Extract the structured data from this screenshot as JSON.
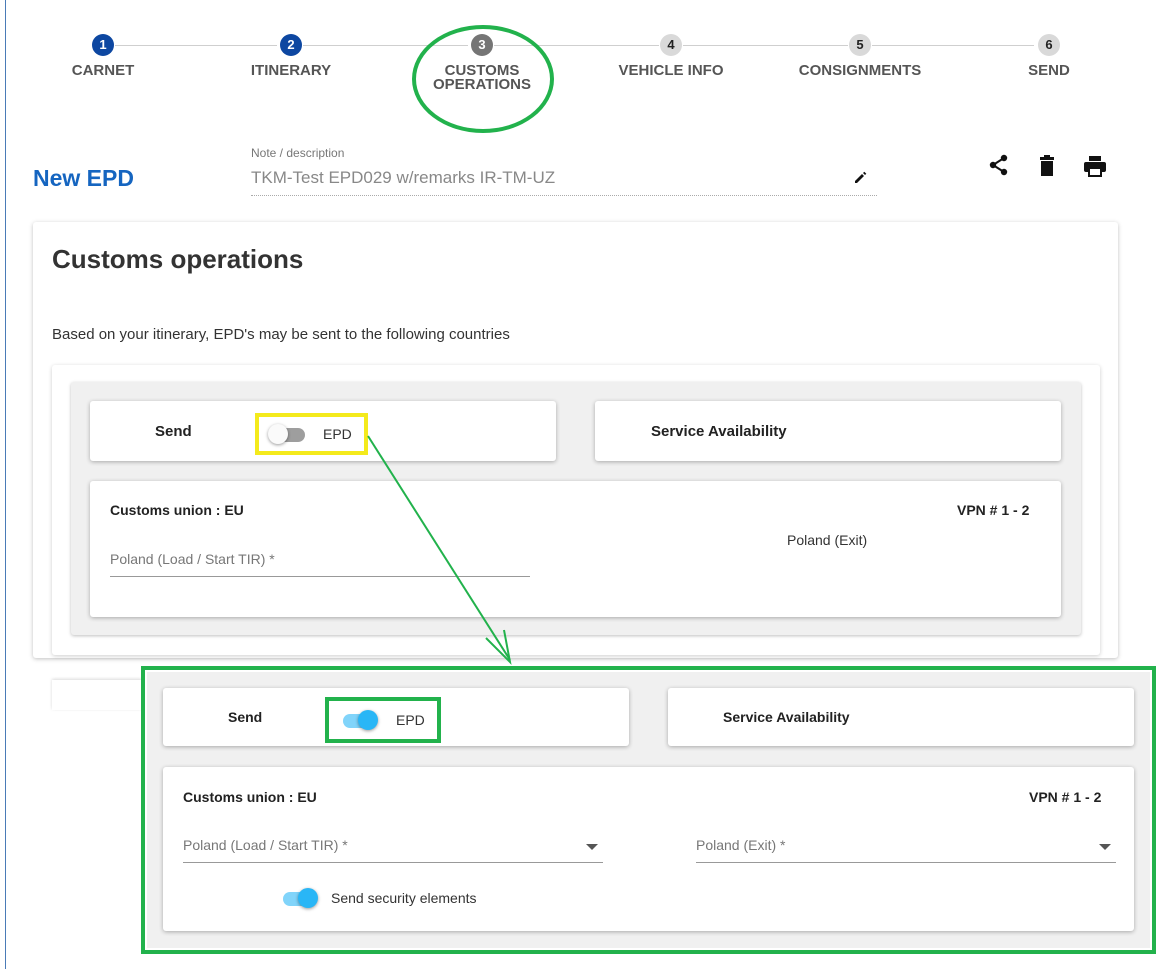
{
  "steps": [
    {
      "number": "1",
      "label": "CARNET",
      "state": "done"
    },
    {
      "number": "2",
      "label": "ITINERARY",
      "state": "done"
    },
    {
      "number": "3",
      "label_line1": "CUSTOMS",
      "label_line2": "OPERATIONS",
      "state": "current"
    },
    {
      "number": "4",
      "label": "VEHICLE INFO",
      "state": "todo"
    },
    {
      "number": "5",
      "label": "CONSIGNMENTS",
      "state": "todo"
    },
    {
      "number": "6",
      "label": "SEND",
      "state": "todo"
    }
  ],
  "header": {
    "title": "New EPD",
    "note_label": "Note / description",
    "note_value": "TKM-Test EPD029 w/remarks IR-TM-UZ",
    "actions": [
      "share-icon",
      "delete-icon",
      "print-icon"
    ]
  },
  "customs": {
    "title": "Customs operations",
    "description": "Based on your itinerary, EPD's may be sent to the following countries"
  },
  "before": {
    "send_label": "Send",
    "epd_label": "EPD",
    "epd_enabled": false,
    "service_availability": "Service Availability",
    "customs_union": "Customs union : EU",
    "vpn": "VPN # 1 - 2",
    "load_placeholder": "Poland (Load / Start TIR) *",
    "exit_text": "Poland (Exit)"
  },
  "after": {
    "send_label": "Send",
    "epd_label": "EPD",
    "epd_enabled": true,
    "service_availability": "Service Availability",
    "customs_union": "Customs union : EU",
    "vpn": "VPN # 1 - 2",
    "load_placeholder": "Poland (Load / Start TIR) *",
    "exit_placeholder": "Poland (Exit) *",
    "security_label": "Send security elements",
    "security_enabled": true
  },
  "colors": {
    "accent_blue": "#1565c0",
    "step_done": "#0d47a1",
    "highlight_green": "#22b24c",
    "highlight_yellow": "#f4ea1c",
    "toggle_on": "#29b6f6"
  }
}
